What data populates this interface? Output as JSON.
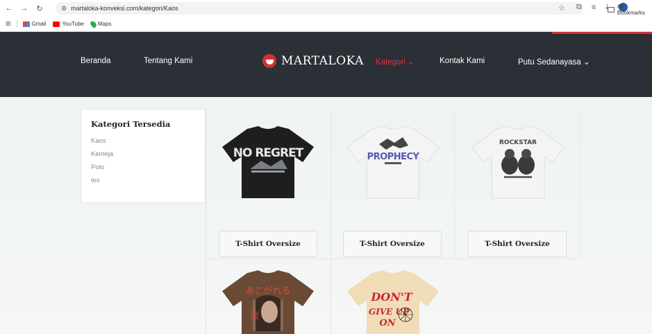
{
  "browser": {
    "url": "martaloka-konveksi.com/kategori/Kaos",
    "bookmarks": [
      {
        "label": "Gmail",
        "icon": "gmail-icon"
      },
      {
        "label": "YouTube",
        "icon": "youtube-icon"
      },
      {
        "label": "Maps",
        "icon": "maps-icon"
      }
    ],
    "all_bookmarks": "All Bookmarks"
  },
  "header": {
    "nav_left": [
      "Beranda",
      "Tentang Kami"
    ],
    "logo": "MARTALOKA",
    "nav_right": {
      "kategori": "Kategori ⌄",
      "kontak": "Kontak Kami",
      "user": "Putu Sedanayasa ⌄"
    },
    "accent_color": "#e0323c",
    "bg_color": "#2b2f36"
  },
  "sidebar": {
    "title": "Kategori Tersedia",
    "items": [
      "Kaos",
      "Kemeja",
      "Polo",
      "tes"
    ]
  },
  "products": [
    {
      "title": "T-Shirt Oversize",
      "color": "#1e1e1e",
      "graphic": "NO REGRET"
    },
    {
      "title": "T-Shirt Oversize",
      "color": "#f4f4f4",
      "graphic": "PROPHECY"
    },
    {
      "title": "T-Shirt Oversize",
      "color": "#f4f4f4",
      "graphic": "bears"
    },
    {
      "title": "",
      "color": "#6b4a35",
      "graphic": "あこがれる"
    },
    {
      "title": "",
      "color": "#f1dcb8",
      "graphic": "DON'T GIVE UP ON"
    }
  ]
}
